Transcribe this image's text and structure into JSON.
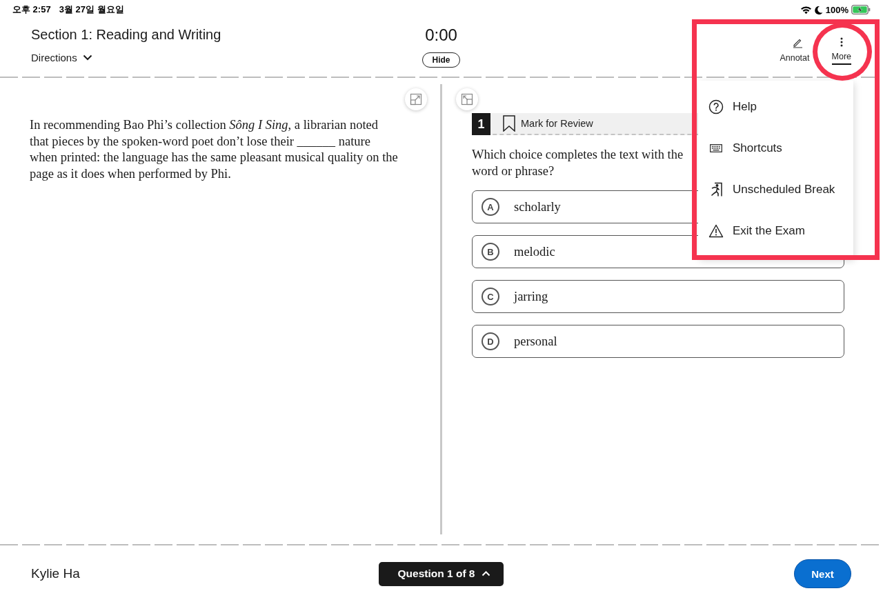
{
  "status_bar": {
    "time": "오후 2:57",
    "date": "3월 27일 월요일",
    "battery": "100%"
  },
  "header": {
    "title": "Section 1: Reading and Writing",
    "directions": "Directions",
    "timer": "0:00",
    "hide_button": "Hide",
    "tools": [
      {
        "kind": "annotate",
        "label": "Annotat",
        "selected": false
      },
      {
        "kind": "more",
        "label": "More",
        "selected": true
      }
    ]
  },
  "passage": {
    "text": "In recommending Bao Phi’s collection *Sông I Sing*, a librarian noted that pieces by the spoken-word poet don’t lose their ______ nature when printed: the language has the same pleasant musical quality on the page as it does when performed by Phi."
  },
  "question": {
    "number": "1",
    "mark_for_review": "Mark for Review",
    "marked": false,
    "prompt_lines": [
      "Which choice completes the text with the",
      "word or phrase?"
    ],
    "choices": [
      {
        "letter": "A",
        "text": "scholarly",
        "selected": false
      },
      {
        "letter": "B",
        "text": "melodic",
        "selected": false
      },
      {
        "letter": "C",
        "text": "jarring",
        "selected": false
      },
      {
        "letter": "D",
        "text": "personal",
        "selected": false
      }
    ]
  },
  "more_menu": {
    "items": [
      {
        "kind": "help",
        "label": "Help"
      },
      {
        "kind": "shortcuts",
        "label": "Shortcuts"
      },
      {
        "kind": "break",
        "label": "Unscheduled Break"
      },
      {
        "kind": "exit",
        "label": "Exit the Exam"
      }
    ]
  },
  "footer": {
    "student": "Kylie Ha",
    "question_nav": "Question 1 of 8",
    "next_button": "Next"
  },
  "highlight_marks": [
    {
      "kind": "rectangle"
    },
    {
      "kind": "circle"
    }
  ]
}
